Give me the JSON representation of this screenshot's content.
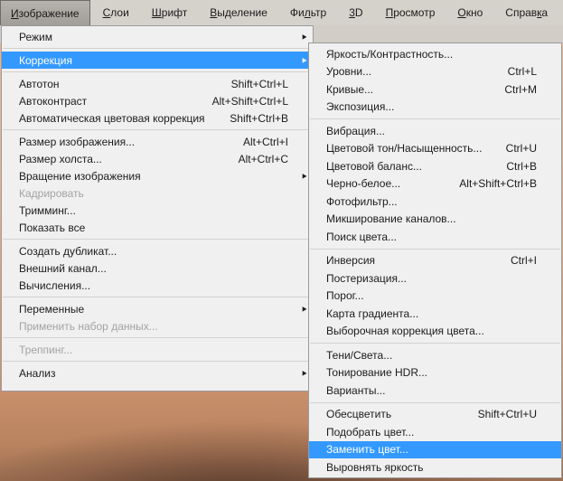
{
  "colors": {
    "selection_blue": "#3399ff",
    "menubar_bg": "#d5d2cb",
    "menu_bg": "#f0f0f0",
    "menu_border": "#9b9b9b",
    "disabled_text": "#a3a3a3",
    "skin_light": "#e9b492",
    "skin_dark": "#9c6f52",
    "brow_dark": "#3e281e"
  },
  "icons": {
    "submenu_arrow": "►"
  },
  "menubar": {
    "items": [
      {
        "pre": "",
        "u": "И",
        "post": "зображение",
        "pressed": true
      },
      {
        "pre": "",
        "u": "С",
        "post": "лои"
      },
      {
        "pre": "",
        "u": "Ш",
        "post": "рифт"
      },
      {
        "pre": "",
        "u": "В",
        "post": "ыделение"
      },
      {
        "pre": "Фи",
        "u": "л",
        "post": "ьтр"
      },
      {
        "pre": "",
        "u": "3",
        "post": "D"
      },
      {
        "pre": "",
        "u": "П",
        "post": "росмотр"
      },
      {
        "pre": "",
        "u": "О",
        "post": "кно"
      },
      {
        "pre": "Справ",
        "u": "к",
        "post": "а"
      }
    ]
  },
  "image_menu": {
    "items": [
      {
        "label": "Режим",
        "submenu": true
      },
      {
        "type": "sep"
      },
      {
        "label": "Коррекция",
        "submenu": true,
        "selected": true
      },
      {
        "type": "sep"
      },
      {
        "label": "Автотон",
        "shortcut": "Shift+Ctrl+L"
      },
      {
        "label": "Автоконтраст",
        "shortcut": "Alt+Shift+Ctrl+L"
      },
      {
        "label": "Автоматическая цветовая коррекция",
        "shortcut": "Shift+Ctrl+B"
      },
      {
        "type": "sep"
      },
      {
        "label": "Размер изображения...",
        "shortcut": "Alt+Ctrl+I"
      },
      {
        "label": "Размер холста...",
        "shortcut": "Alt+Ctrl+C"
      },
      {
        "label": "Вращение изображения",
        "submenu": true
      },
      {
        "label": "Кадрировать",
        "disabled": true
      },
      {
        "label": "Тримминг..."
      },
      {
        "label": "Показать все"
      },
      {
        "type": "sep"
      },
      {
        "label": "Создать дубликат..."
      },
      {
        "label": "Внешний канал..."
      },
      {
        "label": "Вычисления..."
      },
      {
        "type": "sep"
      },
      {
        "label": "Переменные",
        "submenu": true
      },
      {
        "label": "Применить набор данных...",
        "disabled": true
      },
      {
        "type": "sep"
      },
      {
        "label": "Треппинг...",
        "disabled": true
      },
      {
        "type": "sep"
      },
      {
        "label": "Анализ",
        "submenu": true
      }
    ]
  },
  "adjustments_submenu": {
    "items": [
      {
        "label": "Яркость/Контрастность..."
      },
      {
        "label": "Уровни...",
        "shortcut": "Ctrl+L"
      },
      {
        "label": "Кривые...",
        "shortcut": "Ctrl+M"
      },
      {
        "label": "Экспозиция..."
      },
      {
        "type": "sep"
      },
      {
        "label": "Вибрация..."
      },
      {
        "label": "Цветовой тон/Насыщенность...",
        "shortcut": "Ctrl+U"
      },
      {
        "label": "Цветовой баланс...",
        "shortcut": "Ctrl+B"
      },
      {
        "label": "Черно-белое...",
        "shortcut": "Alt+Shift+Ctrl+B"
      },
      {
        "label": "Фотофильтр..."
      },
      {
        "label": "Микширование каналов..."
      },
      {
        "label": "Поиск цвета..."
      },
      {
        "type": "sep"
      },
      {
        "label": "Инверсия",
        "shortcut": "Ctrl+I"
      },
      {
        "label": "Постеризация..."
      },
      {
        "label": "Порог..."
      },
      {
        "label": "Карта градиента..."
      },
      {
        "label": "Выборочная коррекция цвета..."
      },
      {
        "type": "sep"
      },
      {
        "label": "Тени/Света..."
      },
      {
        "label": "Тонирование HDR..."
      },
      {
        "label": "Варианты..."
      },
      {
        "type": "sep"
      },
      {
        "label": "Обесцветить",
        "shortcut": "Shift+Ctrl+U"
      },
      {
        "label": "Подобрать цвет..."
      },
      {
        "label": "Заменить цвет...",
        "selected": true
      },
      {
        "label": "Выровнять яркость"
      }
    ]
  }
}
